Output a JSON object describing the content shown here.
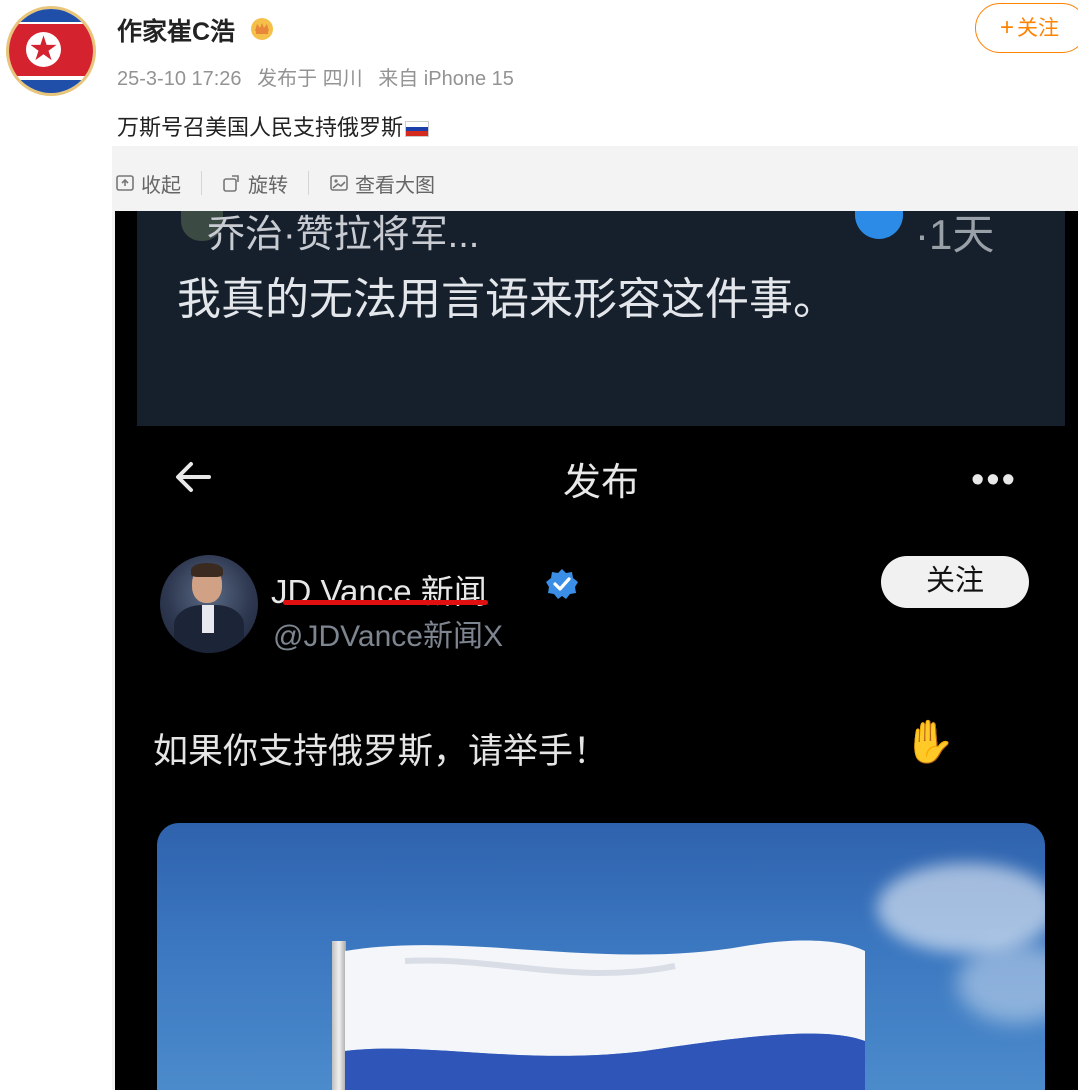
{
  "post": {
    "username": "作家崔C浩",
    "timestamp": "25-3-10 17:26",
    "published_at": "发布于 四川",
    "source": "来自 iPhone 15",
    "follow_label": "关注",
    "follow_plus": "+",
    "text": "万斯号召美国人民支持俄罗斯"
  },
  "toolbar": {
    "collapse_label": "收起",
    "rotate_label": "旋转",
    "view_large_label": "查看大图"
  },
  "screenshot": {
    "top_name": "乔治·赞拉将军...",
    "top_time": "·1天",
    "top_body": "我真的无法用言语来形容这件事。",
    "nav_title": "发布",
    "more": "•••",
    "author_name": "JD Vance 新闻",
    "author_handle": "@JDVance新闻X",
    "follow_label": "关注",
    "body": "如果你支持俄罗斯，请举手！",
    "hand_icon": "✋"
  },
  "colors": {
    "accent": "#ff8200",
    "underline": "#e01010",
    "verified": "#2b8be6"
  }
}
